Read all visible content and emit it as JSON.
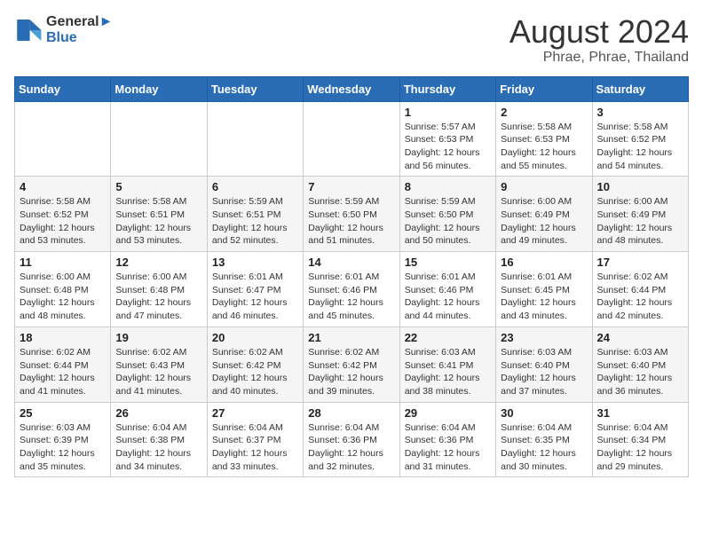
{
  "logo": {
    "line1": "General",
    "line2": "Blue"
  },
  "title": "August 2024",
  "subtitle": "Phrae, Phrae, Thailand",
  "days_header": [
    "Sunday",
    "Monday",
    "Tuesday",
    "Wednesday",
    "Thursday",
    "Friday",
    "Saturday"
  ],
  "weeks": [
    [
      {
        "day": "",
        "info": ""
      },
      {
        "day": "",
        "info": ""
      },
      {
        "day": "",
        "info": ""
      },
      {
        "day": "",
        "info": ""
      },
      {
        "day": "1",
        "info": "Sunrise: 5:57 AM\nSunset: 6:53 PM\nDaylight: 12 hours\nand 56 minutes."
      },
      {
        "day": "2",
        "info": "Sunrise: 5:58 AM\nSunset: 6:53 PM\nDaylight: 12 hours\nand 55 minutes."
      },
      {
        "day": "3",
        "info": "Sunrise: 5:58 AM\nSunset: 6:52 PM\nDaylight: 12 hours\nand 54 minutes."
      }
    ],
    [
      {
        "day": "4",
        "info": "Sunrise: 5:58 AM\nSunset: 6:52 PM\nDaylight: 12 hours\nand 53 minutes."
      },
      {
        "day": "5",
        "info": "Sunrise: 5:58 AM\nSunset: 6:51 PM\nDaylight: 12 hours\nand 53 minutes."
      },
      {
        "day": "6",
        "info": "Sunrise: 5:59 AM\nSunset: 6:51 PM\nDaylight: 12 hours\nand 52 minutes."
      },
      {
        "day": "7",
        "info": "Sunrise: 5:59 AM\nSunset: 6:50 PM\nDaylight: 12 hours\nand 51 minutes."
      },
      {
        "day": "8",
        "info": "Sunrise: 5:59 AM\nSunset: 6:50 PM\nDaylight: 12 hours\nand 50 minutes."
      },
      {
        "day": "9",
        "info": "Sunrise: 6:00 AM\nSunset: 6:49 PM\nDaylight: 12 hours\nand 49 minutes."
      },
      {
        "day": "10",
        "info": "Sunrise: 6:00 AM\nSunset: 6:49 PM\nDaylight: 12 hours\nand 48 minutes."
      }
    ],
    [
      {
        "day": "11",
        "info": "Sunrise: 6:00 AM\nSunset: 6:48 PM\nDaylight: 12 hours\nand 48 minutes."
      },
      {
        "day": "12",
        "info": "Sunrise: 6:00 AM\nSunset: 6:48 PM\nDaylight: 12 hours\nand 47 minutes."
      },
      {
        "day": "13",
        "info": "Sunrise: 6:01 AM\nSunset: 6:47 PM\nDaylight: 12 hours\nand 46 minutes."
      },
      {
        "day": "14",
        "info": "Sunrise: 6:01 AM\nSunset: 6:46 PM\nDaylight: 12 hours\nand 45 minutes."
      },
      {
        "day": "15",
        "info": "Sunrise: 6:01 AM\nSunset: 6:46 PM\nDaylight: 12 hours\nand 44 minutes."
      },
      {
        "day": "16",
        "info": "Sunrise: 6:01 AM\nSunset: 6:45 PM\nDaylight: 12 hours\nand 43 minutes."
      },
      {
        "day": "17",
        "info": "Sunrise: 6:02 AM\nSunset: 6:44 PM\nDaylight: 12 hours\nand 42 minutes."
      }
    ],
    [
      {
        "day": "18",
        "info": "Sunrise: 6:02 AM\nSunset: 6:44 PM\nDaylight: 12 hours\nand 41 minutes."
      },
      {
        "day": "19",
        "info": "Sunrise: 6:02 AM\nSunset: 6:43 PM\nDaylight: 12 hours\nand 41 minutes."
      },
      {
        "day": "20",
        "info": "Sunrise: 6:02 AM\nSunset: 6:42 PM\nDaylight: 12 hours\nand 40 minutes."
      },
      {
        "day": "21",
        "info": "Sunrise: 6:02 AM\nSunset: 6:42 PM\nDaylight: 12 hours\nand 39 minutes."
      },
      {
        "day": "22",
        "info": "Sunrise: 6:03 AM\nSunset: 6:41 PM\nDaylight: 12 hours\nand 38 minutes."
      },
      {
        "day": "23",
        "info": "Sunrise: 6:03 AM\nSunset: 6:40 PM\nDaylight: 12 hours\nand 37 minutes."
      },
      {
        "day": "24",
        "info": "Sunrise: 6:03 AM\nSunset: 6:40 PM\nDaylight: 12 hours\nand 36 minutes."
      }
    ],
    [
      {
        "day": "25",
        "info": "Sunrise: 6:03 AM\nSunset: 6:39 PM\nDaylight: 12 hours\nand 35 minutes."
      },
      {
        "day": "26",
        "info": "Sunrise: 6:04 AM\nSunset: 6:38 PM\nDaylight: 12 hours\nand 34 minutes."
      },
      {
        "day": "27",
        "info": "Sunrise: 6:04 AM\nSunset: 6:37 PM\nDaylight: 12 hours\nand 33 minutes."
      },
      {
        "day": "28",
        "info": "Sunrise: 6:04 AM\nSunset: 6:36 PM\nDaylight: 12 hours\nand 32 minutes."
      },
      {
        "day": "29",
        "info": "Sunrise: 6:04 AM\nSunset: 6:36 PM\nDaylight: 12 hours\nand 31 minutes."
      },
      {
        "day": "30",
        "info": "Sunrise: 6:04 AM\nSunset: 6:35 PM\nDaylight: 12 hours\nand 30 minutes."
      },
      {
        "day": "31",
        "info": "Sunrise: 6:04 AM\nSunset: 6:34 PM\nDaylight: 12 hours\nand 29 minutes."
      }
    ]
  ]
}
